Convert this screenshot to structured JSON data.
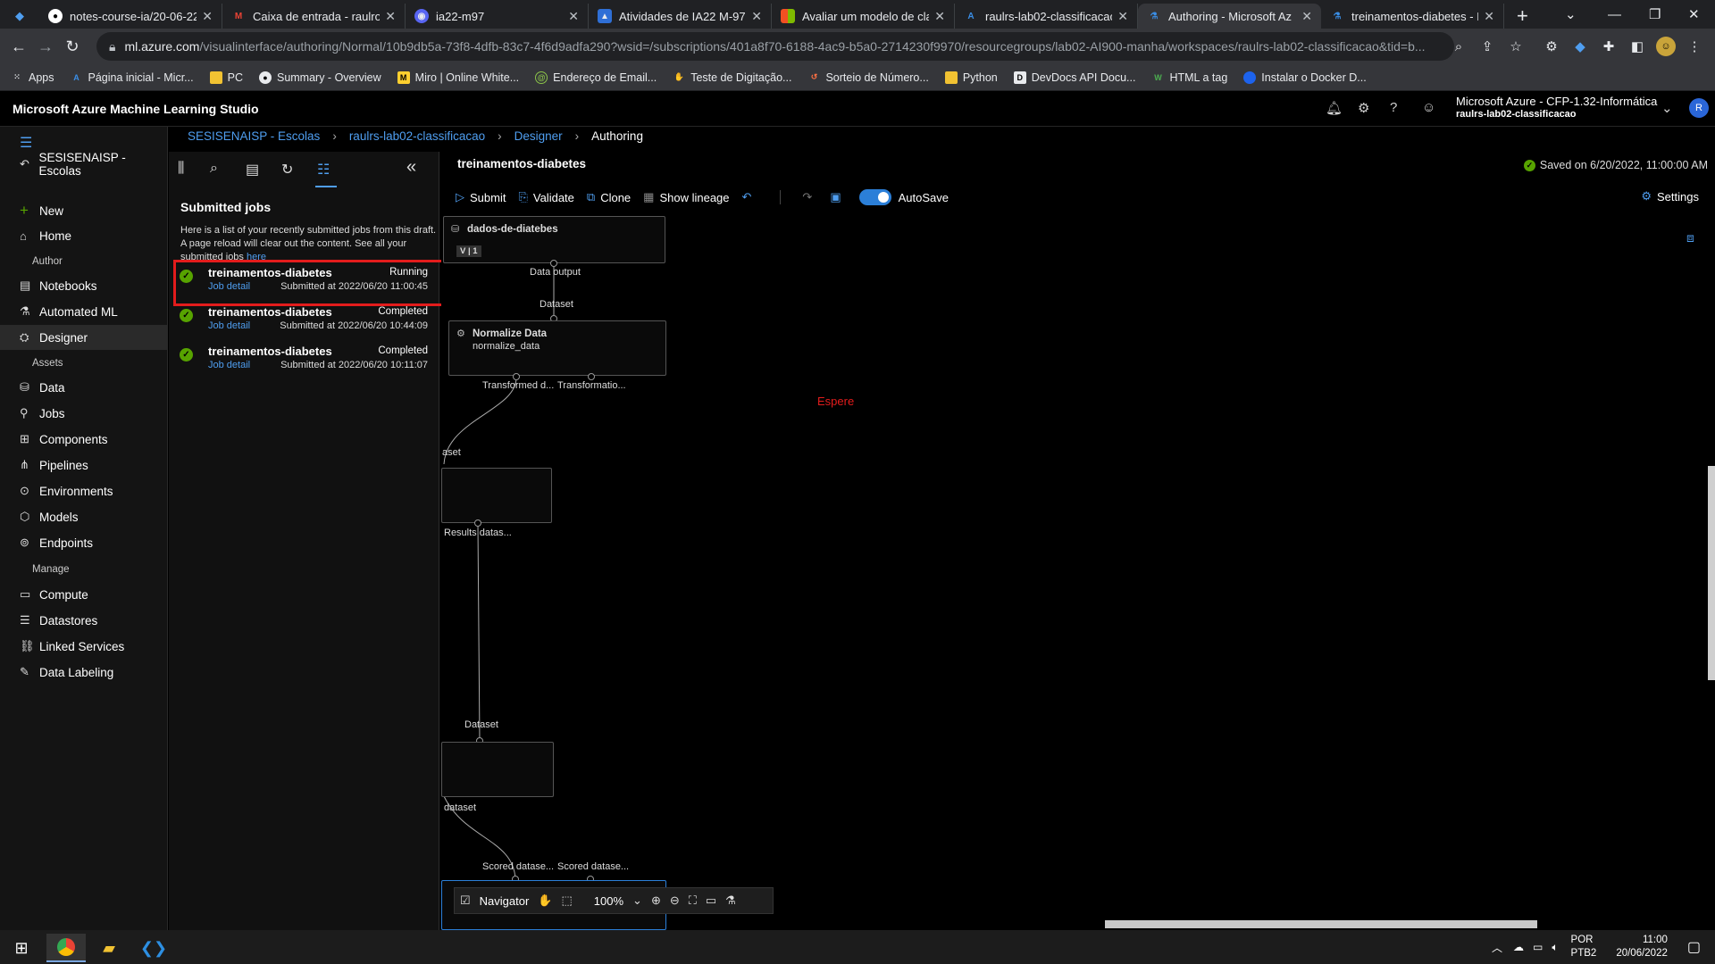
{
  "browser": {
    "tabs": [
      {
        "title": "notes-course-ia/20-06-22",
        "icon": "github-icon"
      },
      {
        "title": "Caixa de entrada - raulrod",
        "icon": "gmail-icon"
      },
      {
        "title": "ia22-m97",
        "icon": "discord-icon"
      },
      {
        "title": "Atividades de IA22 M-97",
        "icon": "moodle-icon"
      },
      {
        "title": "Avaliar um modelo de cla",
        "icon": "microsoft-icon"
      },
      {
        "title": "raulrs-lab02-classificacao",
        "icon": "azure-icon"
      },
      {
        "title": "Authoring - Microsoft Az",
        "icon": "azure-ml-icon"
      },
      {
        "title": "treinamentos-diabetes - I",
        "icon": "azure-ml-icon"
      }
    ],
    "url_host": "ml.azure.com",
    "url_path": "/visualinterface/authoring/Normal/10b9db5a-73f8-4dfb-83c7-4f6d9adfa290?wsid=/subscriptions/401a8f70-6188-4ac9-b5a0-2714230f9970/resourcegroups/lab02-AI900-manha/workspaces/raulrs-lab02-classificacao&tid=b...",
    "bookmarks": [
      "Apps",
      "Página inicial - Micr...",
      "PC",
      "Summary - Overview",
      "Miro | Online White...",
      "Endereço de Email...",
      "Teste de Digitação...",
      "Sorteio de Número...",
      "Python",
      "DevDocs API Docu...",
      "HTML a tag",
      "Instalar o Docker D..."
    ]
  },
  "app": {
    "title": "Microsoft Azure Machine Learning Studio",
    "account_line1": "Microsoft Azure - CFP-1.32-Informática",
    "account_line2": "raulrs-lab02-classificacao",
    "avatar": "R"
  },
  "leftnav": {
    "workspace": "SESISENAISP - Escolas",
    "new": "New",
    "home": "Home",
    "author_label": "Author",
    "notebooks": "Notebooks",
    "automl": "Automated ML",
    "designer": "Designer",
    "assets_label": "Assets",
    "data": "Data",
    "jobs": "Jobs",
    "components": "Components",
    "pipelines": "Pipelines",
    "environments": "Environments",
    "models": "Models",
    "endpoints": "Endpoints",
    "manage_label": "Manage",
    "compute": "Compute",
    "datastores": "Datastores",
    "linked": "Linked Services",
    "labeling": "Data Labeling"
  },
  "breadcrumb": [
    "SESISENAISP - Escolas",
    "raulrs-lab02-classificacao",
    "Designer",
    "Authoring"
  ],
  "jobs_panel": {
    "title": "Submitted jobs",
    "desc": "Here is a list of your recently submitted jobs from this draft. A page reload will clear out the content. See all your submitted jobs",
    "desc_link": "here",
    "jobs": [
      {
        "name": "treinamentos-diabetes",
        "status": "Running",
        "link": "Job detail",
        "submitted": "Submitted at 2022/06/20 11:00:45"
      },
      {
        "name": "treinamentos-diabetes",
        "status": "Completed",
        "link": "Job detail",
        "submitted": "Submitted at 2022/06/20 10:44:09"
      },
      {
        "name": "treinamentos-diabetes",
        "status": "Completed",
        "link": "Job detail",
        "submitted": "Submitted at 2022/06/20 10:11:07"
      }
    ]
  },
  "canvas": {
    "pipeline_name": "treinamentos-diabetes",
    "saved": "Saved on 6/20/2022, 11:00:00 AM",
    "toolbar": {
      "submit": "Submit",
      "validate": "Validate",
      "clone": "Clone",
      "lineage": "Show lineage",
      "autosave": "AutoSave",
      "settings": "Settings"
    },
    "nodes": {
      "dataset_title": "dados-de-diatebes",
      "dataset_version": "V | 1",
      "normalize_title": "Normalize Data",
      "normalize_sub": "normalize_data"
    },
    "ports": {
      "data_output": "Data output",
      "dataset": "Dataset",
      "transformed": "Transformed d...",
      "transformation": "Transformatio...",
      "aset": "aset",
      "results": "Results datas...",
      "dataset2": "Dataset",
      "dataset3": "dataset",
      "scored1": "Scored datase...",
      "scored2": "Scored datase..."
    },
    "espere": "Espere",
    "navigator": {
      "label": "Navigator",
      "zoom": "100%"
    }
  },
  "taskbar": {
    "lang1": "POR",
    "lang2": "PTB2",
    "time": "11:00",
    "date": "20/06/2022"
  }
}
